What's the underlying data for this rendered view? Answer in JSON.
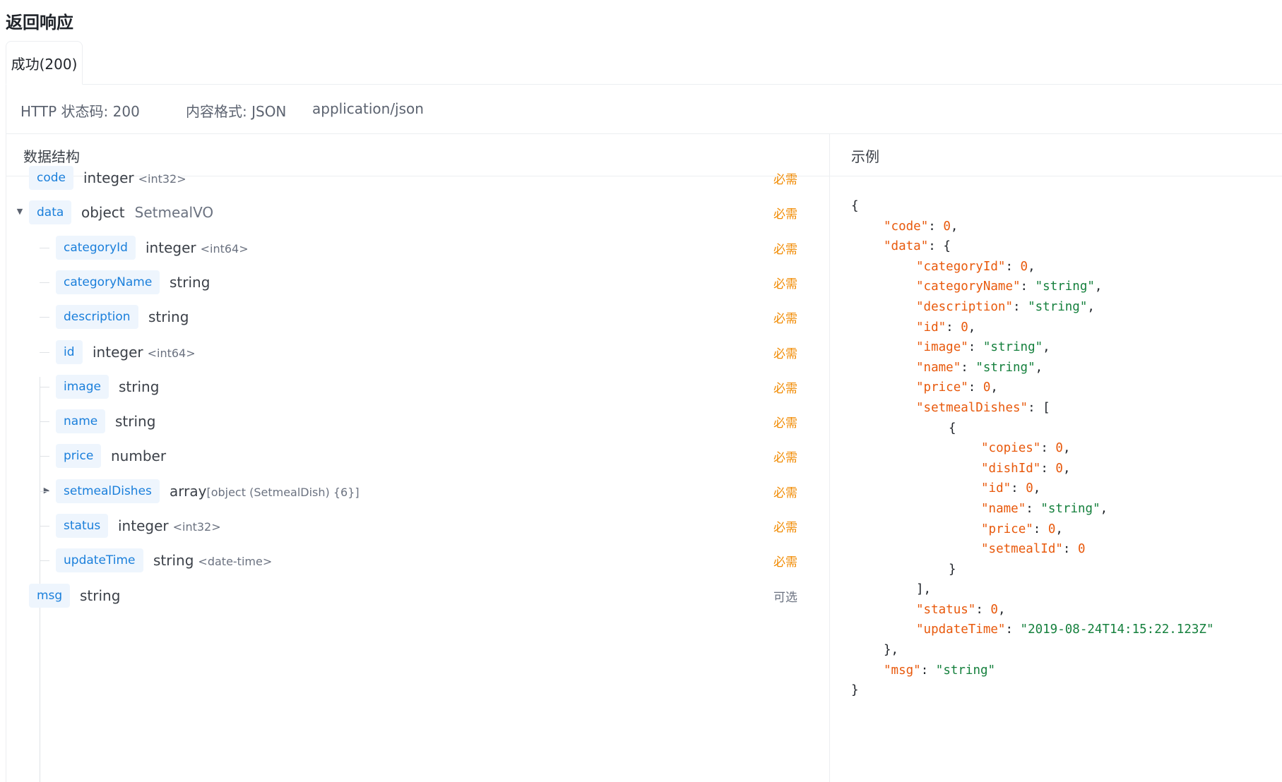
{
  "section_title": "返回响应",
  "tabs": [
    {
      "label": "成功(200)",
      "active": true
    }
  ],
  "meta": {
    "status_text": "HTTP 状态码: 200",
    "format_text": "内容格式: JSON",
    "content_type": "application/json"
  },
  "schema": {
    "header": "数据结构",
    "fields": [
      {
        "name": "code",
        "type": "integer",
        "format": "<int32>",
        "ref": "",
        "array_detail": "",
        "required_label": "必需",
        "required": true,
        "depth": 0,
        "expand": "none"
      },
      {
        "name": "data",
        "type": "object",
        "format": "",
        "ref": "SetmealVO",
        "array_detail": "",
        "required_label": "必需",
        "required": true,
        "depth": 0,
        "expand": "expanded"
      },
      {
        "name": "categoryId",
        "type": "integer",
        "format": "<int64>",
        "ref": "",
        "array_detail": "",
        "required_label": "必需",
        "required": true,
        "depth": 1,
        "expand": "none"
      },
      {
        "name": "categoryName",
        "type": "string",
        "format": "",
        "ref": "",
        "array_detail": "",
        "required_label": "必需",
        "required": true,
        "depth": 1,
        "expand": "none"
      },
      {
        "name": "description",
        "type": "string",
        "format": "",
        "ref": "",
        "array_detail": "",
        "required_label": "必需",
        "required": true,
        "depth": 1,
        "expand": "none"
      },
      {
        "name": "id",
        "type": "integer",
        "format": "<int64>",
        "ref": "",
        "array_detail": "",
        "required_label": "必需",
        "required": true,
        "depth": 1,
        "expand": "none"
      },
      {
        "name": "image",
        "type": "string",
        "format": "",
        "ref": "",
        "array_detail": "",
        "required_label": "必需",
        "required": true,
        "depth": 1,
        "expand": "none"
      },
      {
        "name": "name",
        "type": "string",
        "format": "",
        "ref": "",
        "array_detail": "",
        "required_label": "必需",
        "required": true,
        "depth": 1,
        "expand": "none"
      },
      {
        "name": "price",
        "type": "number",
        "format": "",
        "ref": "",
        "array_detail": "",
        "required_label": "必需",
        "required": true,
        "depth": 1,
        "expand": "none"
      },
      {
        "name": "setmealDishes",
        "type": "array",
        "format": "",
        "ref": "",
        "array_detail": "[object (SetmealDish) {6}]",
        "required_label": "必需",
        "required": true,
        "depth": 1,
        "expand": "collapsed"
      },
      {
        "name": "status",
        "type": "integer",
        "format": "<int32>",
        "ref": "",
        "array_detail": "",
        "required_label": "必需",
        "required": true,
        "depth": 1,
        "expand": "none"
      },
      {
        "name": "updateTime",
        "type": "string",
        "format": "<date-time>",
        "ref": "",
        "array_detail": "",
        "required_label": "必需",
        "required": true,
        "depth": 1,
        "expand": "none"
      },
      {
        "name": "msg",
        "type": "string",
        "format": "",
        "ref": "",
        "array_detail": "",
        "required_label": "可选",
        "required": false,
        "depth": 0,
        "expand": "none"
      }
    ]
  },
  "example": {
    "header": "示例",
    "lines": [
      {
        "indent": 0,
        "key": "",
        "value": "",
        "vtype": "",
        "text": "{"
      },
      {
        "indent": 1,
        "key": "code",
        "value": "0",
        "vtype": "num",
        "text": ","
      },
      {
        "indent": 1,
        "key": "data",
        "value": "",
        "vtype": "",
        "text": "{"
      },
      {
        "indent": 2,
        "key": "categoryId",
        "value": "0",
        "vtype": "num",
        "text": ","
      },
      {
        "indent": 2,
        "key": "categoryName",
        "value": "string",
        "vtype": "str",
        "text": ","
      },
      {
        "indent": 2,
        "key": "description",
        "value": "string",
        "vtype": "str",
        "text": ","
      },
      {
        "indent": 2,
        "key": "id",
        "value": "0",
        "vtype": "num",
        "text": ","
      },
      {
        "indent": 2,
        "key": "image",
        "value": "string",
        "vtype": "str",
        "text": ","
      },
      {
        "indent": 2,
        "key": "name",
        "value": "string",
        "vtype": "str",
        "text": ","
      },
      {
        "indent": 2,
        "key": "price",
        "value": "0",
        "vtype": "num",
        "text": ","
      },
      {
        "indent": 2,
        "key": "setmealDishes",
        "value": "",
        "vtype": "",
        "text": "["
      },
      {
        "indent": 3,
        "key": "",
        "value": "",
        "vtype": "",
        "text": "{"
      },
      {
        "indent": 4,
        "key": "copies",
        "value": "0",
        "vtype": "num",
        "text": ","
      },
      {
        "indent": 4,
        "key": "dishId",
        "value": "0",
        "vtype": "num",
        "text": ","
      },
      {
        "indent": 4,
        "key": "id",
        "value": "0",
        "vtype": "num",
        "text": ","
      },
      {
        "indent": 4,
        "key": "name",
        "value": "string",
        "vtype": "str",
        "text": ","
      },
      {
        "indent": 4,
        "key": "price",
        "value": "0",
        "vtype": "num",
        "text": ","
      },
      {
        "indent": 4,
        "key": "setmealId",
        "value": "0",
        "vtype": "num",
        "text": ""
      },
      {
        "indent": 3,
        "key": "",
        "value": "",
        "vtype": "",
        "text": "}"
      },
      {
        "indent": 2,
        "key": "",
        "value": "",
        "vtype": "",
        "text": "],"
      },
      {
        "indent": 2,
        "key": "status",
        "value": "0",
        "vtype": "num",
        "text": ","
      },
      {
        "indent": 2,
        "key": "updateTime",
        "value": "2019-08-24T14:15:22.123Z",
        "vtype": "str",
        "text": ""
      },
      {
        "indent": 1,
        "key": "",
        "value": "",
        "vtype": "",
        "text": "},"
      },
      {
        "indent": 1,
        "key": "msg",
        "value": "string",
        "vtype": "str",
        "text": ""
      },
      {
        "indent": 0,
        "key": "",
        "value": "",
        "vtype": "",
        "text": "}"
      }
    ]
  }
}
